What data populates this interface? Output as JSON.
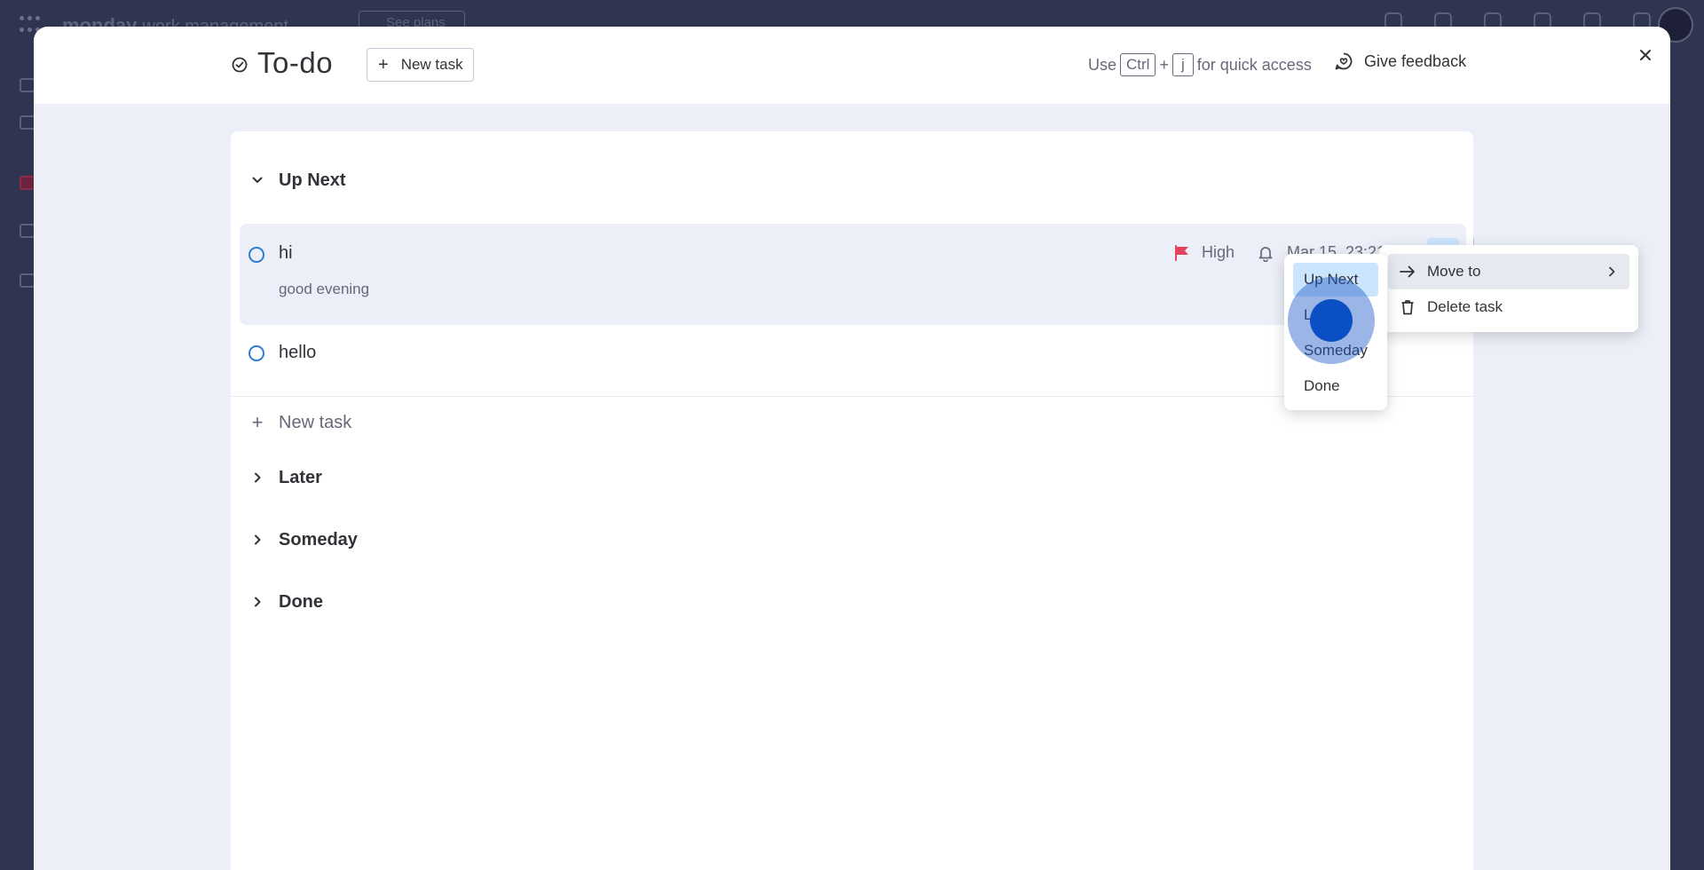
{
  "background": {
    "app_logo": "monday",
    "app_logo_suffix": "work management",
    "plans_label": "See plans"
  },
  "modal": {
    "title": "To-do",
    "new_task_button": "New task",
    "quick_access": {
      "prefix": "Use",
      "key1": "Ctrl",
      "plus": "+",
      "key2": "j",
      "suffix": "for quick access"
    },
    "feedback_label": "Give feedback"
  },
  "sections": {
    "up_next": "Up Next",
    "later": "Later",
    "someday": "Someday",
    "done": "Done"
  },
  "tasks": [
    {
      "name": "hi",
      "note": "good evening",
      "priority": "High",
      "reminder": "Mar 15, 23:21"
    },
    {
      "name": "hello"
    }
  ],
  "add_task_label": "New task",
  "menu": {
    "move_to": "Move to",
    "delete_task": "Delete task",
    "submenu": [
      "Up Next",
      "Later",
      "Someday",
      "Done"
    ]
  },
  "colors": {
    "accent_blue": "#0073ea",
    "priority_flag": "#e2445c",
    "selected_bg": "#cce5ff"
  }
}
